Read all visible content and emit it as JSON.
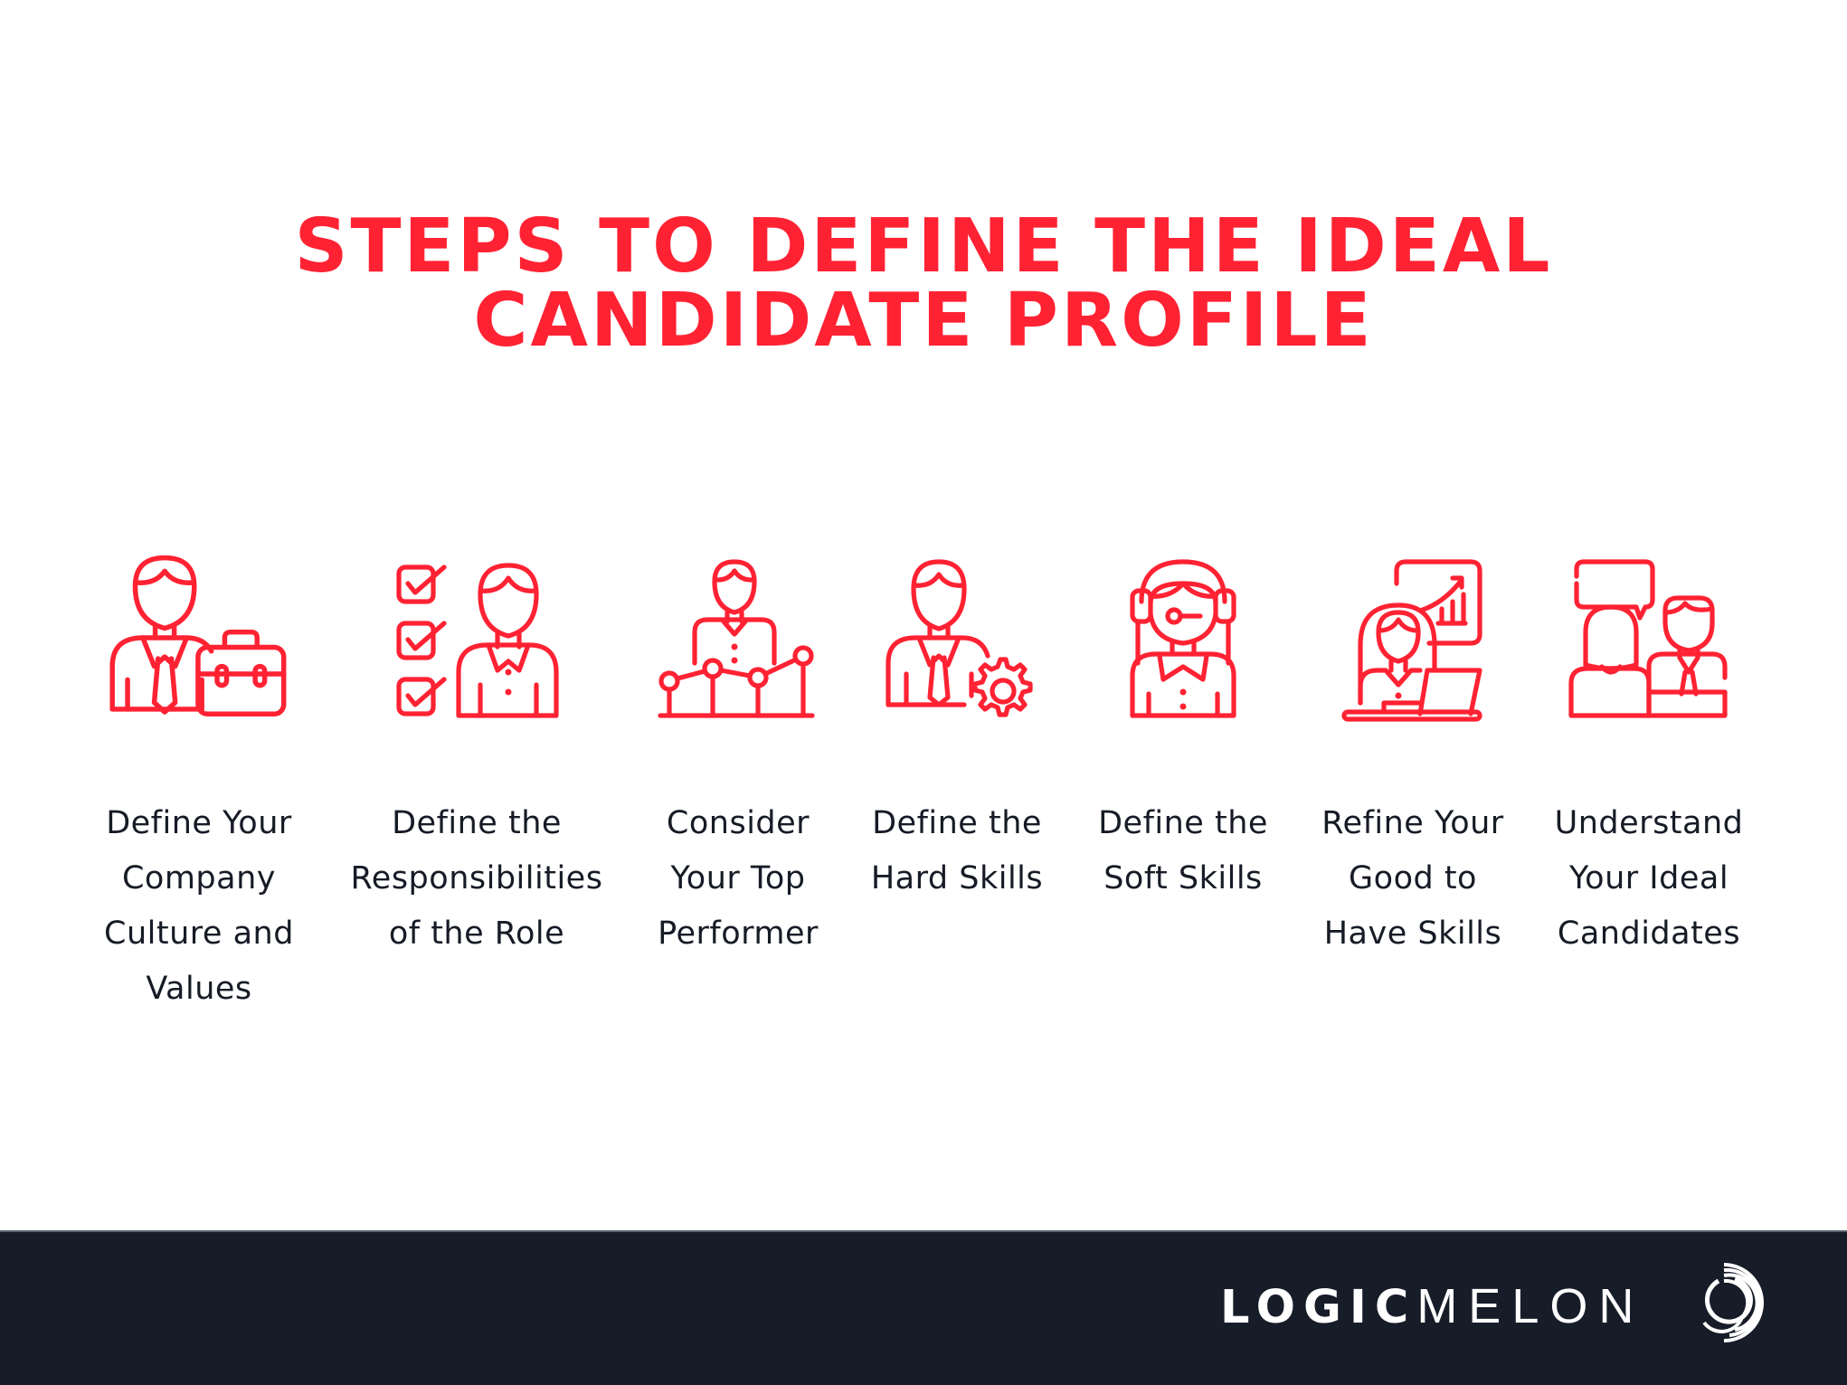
{
  "title": {
    "line1": "STEPS TO DEFINE THE IDEAL",
    "line2": "CANDIDATE PROFILE",
    "color": "#ff2233"
  },
  "steps": [
    {
      "icon": "businessman-briefcase-icon",
      "lines": [
        "Define Your",
        "Company",
        "Culture and",
        "Values"
      ]
    },
    {
      "icon": "checklist-person-icon",
      "lines": [
        "Define the",
        "Responsibilities",
        "of the Role"
      ]
    },
    {
      "icon": "person-performance-chart-icon",
      "lines": [
        "Consider",
        "Your Top",
        "Performer"
      ]
    },
    {
      "icon": "businessman-gear-icon",
      "lines": [
        "Define the",
        "Hard Skills"
      ]
    },
    {
      "icon": "support-headset-woman-icon",
      "lines": [
        "Define the",
        "Soft Skills"
      ]
    },
    {
      "icon": "woman-laptop-presentation-icon",
      "lines": [
        "Refine Your",
        "Good to",
        "Have Skills"
      ]
    },
    {
      "icon": "interview-conversation-icon",
      "lines": [
        "Understand",
        "Your Ideal",
        "Candidates"
      ]
    }
  ],
  "footer": {
    "brand_bold": "LOGIC",
    "brand_light": "MELON",
    "logo_icon": "logicmelon-rings-icon",
    "background": "#171d28"
  }
}
